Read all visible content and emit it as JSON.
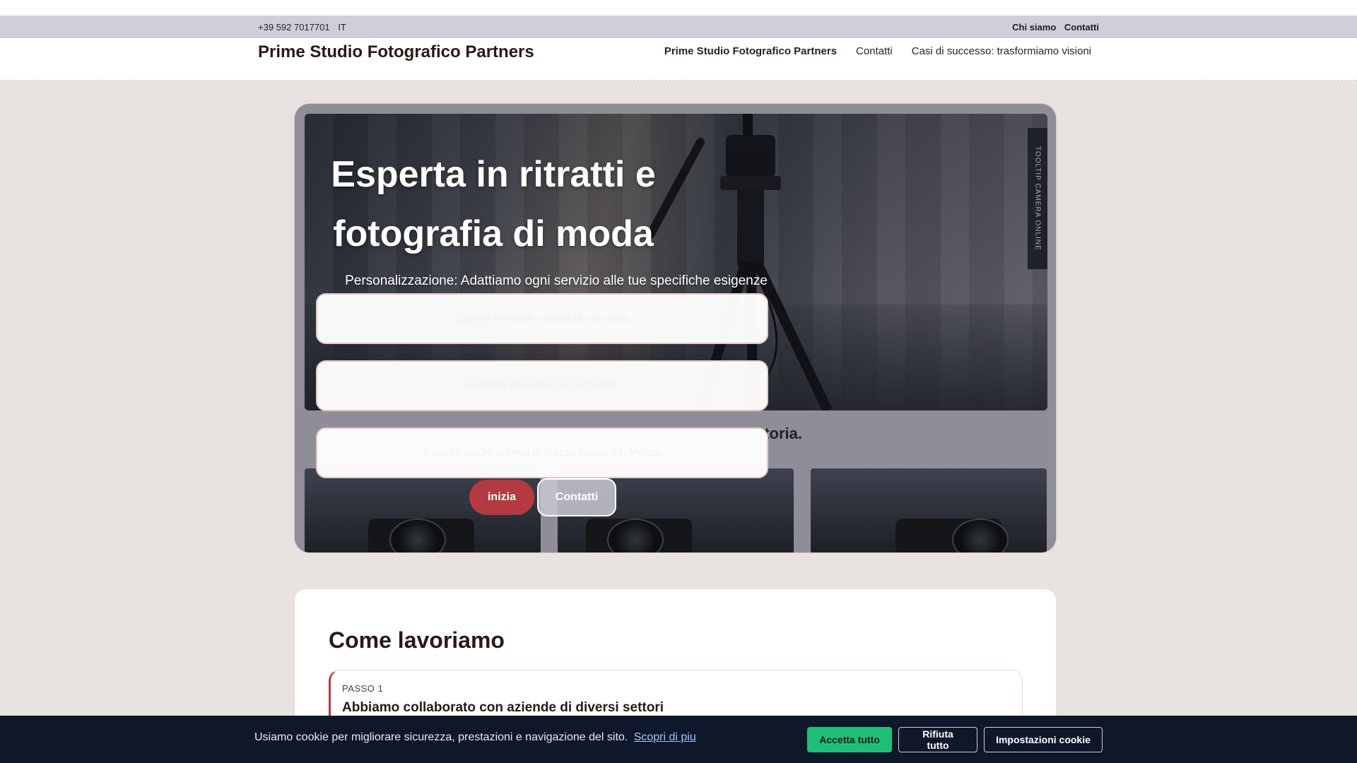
{
  "topbar": {
    "phone": "+39 592 7017701",
    "lang": "IT",
    "links": [
      "Chi siamo",
      "Contatti"
    ]
  },
  "header": {
    "brand": "Prime Studio Fotografico Partners",
    "nav": [
      {
        "label": "Prime Studio Fotografico Partners",
        "active": true
      },
      {
        "label": "Contatti",
        "active": false
      },
      {
        "label": "Casi di successo: trasformiamo visioni",
        "active": false
      }
    ]
  },
  "hero": {
    "title": "Esperta in ritratti e fotografia di moda",
    "subtitle": "Personalizzazione: Adattiamo ogni servizio alle tue specifiche esigenze",
    "fields": [
      "Esperta in ritratti e fotografia di moda",
      "Il Nostro Impegno per la Qualità",
      "Il nostro studio si trova in Piazza Rosso 14, Monza"
    ],
    "image_text": "storia.",
    "image_badge": "TOOLTIP CAMERA ONLINE",
    "cta_primary": "inizia",
    "cta_secondary": "Contatti"
  },
  "process": {
    "title": "Come lavoriamo",
    "steps": [
      {
        "label": "PASSO 1",
        "title": "Abbiamo collaborato con aziende di diversi settori"
      }
    ]
  },
  "cookie": {
    "message": "Usiamo cookie per migliorare sicurezza, prestazioni e navigazione del sito.",
    "link": "Scopri di piu",
    "accept": "Accetta tutto",
    "reject": "Rifiuta tutto",
    "settings": "Impostazioni cookie"
  },
  "colors": {
    "accent": "#b33a40",
    "page_bg": "#e8e3e0",
    "topbar_bg": "#cfcfd9",
    "cookie_bg": "#0f172a",
    "accept_green": "#1fbf78"
  }
}
